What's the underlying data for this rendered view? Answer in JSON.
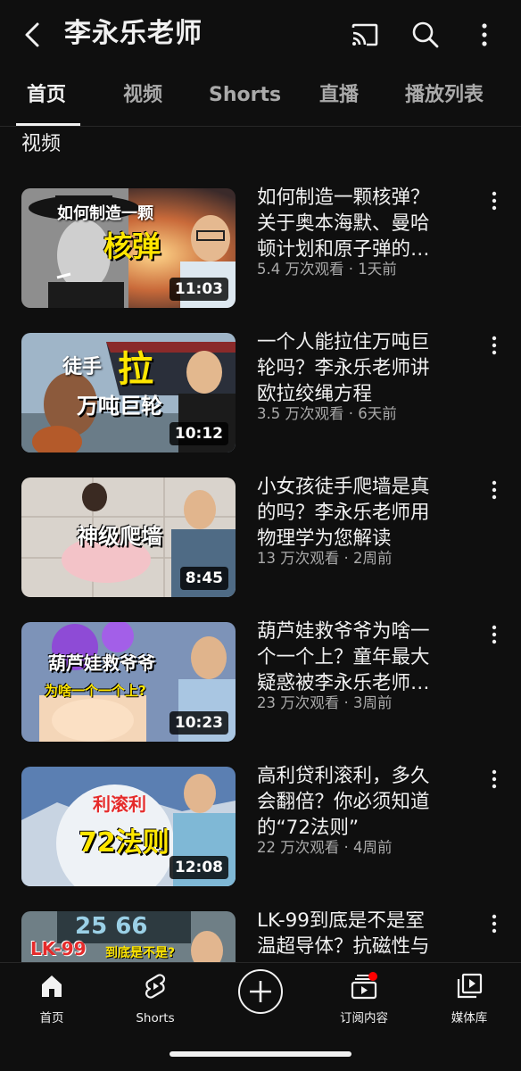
{
  "header": {
    "channel_name": "李永乐老师",
    "icons": [
      "back-icon",
      "cast-icon",
      "search-icon",
      "more-vert-icon"
    ]
  },
  "tabs": [
    {
      "label": "首页",
      "active": true
    },
    {
      "label": "视频",
      "active": false
    },
    {
      "label": "Shorts",
      "active": false
    },
    {
      "label": "直播",
      "active": false
    },
    {
      "label": "播放列表",
      "active": false
    }
  ],
  "section_label": "视频",
  "videos": [
    {
      "title_lines": [
        "如何制造一颗核弹？",
        "关于奥本海默、曼哈",
        "顿计划和原子弹的…"
      ],
      "meta": "5.4 万次观看 · 1天前",
      "duration": "11:03",
      "thumb_text": [
        "如何制造一颗",
        "核弹"
      ]
    },
    {
      "title_lines": [
        "一个人能拉住万吨巨",
        "轮吗？李永乐老师讲",
        "欧拉绞绳方程"
      ],
      "meta": "3.5 万次观看 · 6天前",
      "duration": "10:12",
      "thumb_text": [
        "徒手",
        "拉",
        "万吨巨轮"
      ]
    },
    {
      "title_lines": [
        "小女孩徒手爬墙是真",
        "的吗？李永乐老师用",
        "物理学为您解读"
      ],
      "meta": "13 万次观看 · 2周前",
      "duration": "8:45",
      "thumb_text": [
        "神级爬墙"
      ]
    },
    {
      "title_lines": [
        "葫芦娃救爷爷为啥一",
        "个一个上？童年最大",
        "疑惑被李永乐老师…"
      ],
      "meta": "23 万次观看 · 3周前",
      "duration": "10:23",
      "thumb_text": [
        "葫芦娃救爷爷",
        "为啥一个一个上?"
      ]
    },
    {
      "title_lines": [
        "高利贷利滚利，多久",
        "会翻倍？你必须知道",
        "的“72法则”"
      ],
      "meta": "22 万次观看 · 4周前",
      "duration": "12:08",
      "thumb_text": [
        "利滚利",
        "72法则"
      ]
    },
    {
      "title_lines": [
        "LK-99到底是不是室",
        "温超导体？抗磁性与"
      ],
      "meta": "",
      "duration": "",
      "thumb_text": [
        "LK-99",
        "到底是不是?",
        "25",
        "66"
      ]
    }
  ],
  "bottom_nav": [
    {
      "label": "首页",
      "icon": "home-icon",
      "active": true
    },
    {
      "label": "Shorts",
      "icon": "shorts-icon",
      "active": false
    },
    {
      "label": "",
      "icon": "create-plus-icon",
      "active": false
    },
    {
      "label": "订阅内容",
      "icon": "subscriptions-icon",
      "active": false,
      "notification_dot": true
    },
    {
      "label": "媒体库",
      "icon": "library-icon",
      "active": false
    }
  ],
  "colors": {
    "background": "#0f0f0f",
    "text_primary": "#f1f1f1",
    "text_secondary": "#aaaaaa",
    "notification": "#ff0000",
    "thumb_yellow": "#ffe600"
  }
}
